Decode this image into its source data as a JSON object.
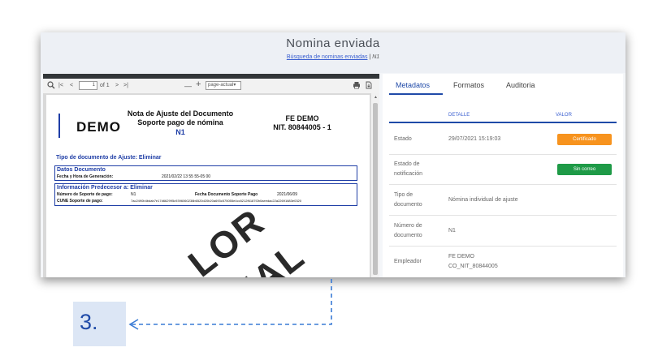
{
  "header": {
    "title": "Nomina enviada",
    "breadcrumb_link": "Búsqueda de nominas enviadas",
    "breadcrumb_sep": "|",
    "breadcrumb_current": "N1"
  },
  "viewer": {
    "toolbar": {
      "search_icon": "search-icon",
      "first": "|<",
      "prev": "<",
      "page_value": "1",
      "page_of": "of 1",
      "next": ">",
      "last": ">|",
      "zoom_out": "—",
      "zoom_in": "+",
      "zoom_select": "page-actual",
      "print_icon": "print-icon",
      "download_icon": "download-icon"
    },
    "doc": {
      "logo": "DEMO",
      "title_line1": "Nota de Ajuste del Documento",
      "title_line2": "Soporte pago de nómina",
      "code": "N1",
      "issuer_name": "FE DEMO",
      "issuer_nit": "NIT. 80844005 - 1",
      "adjust_type": "Tipo de documento de Ajuste: Eliminar",
      "datos_title": "Datos Documento",
      "fecha_label": "Fecha y Hora de Generación:",
      "fecha_value": "2021/02/22 13 55 55-05 00",
      "predecesor_title": "Información Predecesor a: Eliminar",
      "num_label": "Número de Soporte de pago:",
      "num_value": "N1",
      "fecha_soporte_label": "Fecha Documento Soporte Pago",
      "fecha_soporte_value": "2021/06/09",
      "cune_label": "CUNE Soporte de pago:",
      "cune_value": "7ac2490b4bdab7e17d662995c9396060238b6520d20b20a693c575055e4cc5212f6187f2b0aeedac22a22691683e0320",
      "watermark_line1": "LOR",
      "watermark_line2": "IAL"
    }
  },
  "panel": {
    "tabs": [
      "Metadatos",
      "Formatos",
      "Auditoria"
    ],
    "col_detail": "DETALLE",
    "col_value": "VALOR",
    "rows": [
      {
        "label": "Estado",
        "detail": "29/07/2021 15:19:03",
        "badge": "Certificado"
      },
      {
        "label": "Estado de notificación",
        "detail": "",
        "badge": "Sin correo"
      },
      {
        "label": "Tipo de documento",
        "detail": "Nómina individual de ajuste"
      },
      {
        "label": "Número de documento",
        "detail": "N1"
      },
      {
        "label": "Empleador",
        "detail_line1": "FE DEMO",
        "detail_line2": "CO_NIT_80844005"
      }
    ]
  },
  "annotation": {
    "step": "3."
  },
  "colors": {
    "accent": "#1f4aa8",
    "badge_orange": "#f7931e",
    "badge_green": "#1e9a47",
    "annotation_arrow": "#3a7bd5"
  }
}
